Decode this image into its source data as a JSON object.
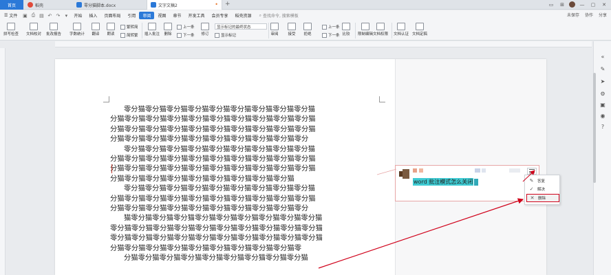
{
  "tabs": {
    "home": "首页",
    "docer": "稻壳",
    "doc1": "零分猫脚本.docx",
    "doc2": "文字文稿2",
    "add": "+"
  },
  "window": {
    "minimize": "—",
    "maximize": "▢",
    "close": "✕"
  },
  "menu": {
    "file": "文件",
    "items": [
      "开始",
      "插入",
      "页面布局",
      "引用",
      "审阅",
      "视图",
      "章节",
      "开发工具",
      "会员专享",
      "稻壳资源"
    ],
    "active_index": 4,
    "search_placeholder": "查找命令, 搜索模板",
    "right": [
      "未保存",
      "协作",
      "分享"
    ]
  },
  "ribbon": {
    "spell_check": "拼写检查",
    "doc_proof": "文档校对",
    "check_report": "批改报告",
    "word_count": "字数统计",
    "translate": "翻译",
    "read_aloud": "朗读",
    "trad": "繁转简",
    "simp": "简转繁",
    "insert_comment": "插入批注",
    "delete": "删除",
    "prev": "上一条",
    "next": "下一条",
    "track": "修订",
    "show_select": "显示标记的最终状态",
    "show_mark": "显示标记",
    "review": "审阅",
    "accept": "接受",
    "reject": "拒绝",
    "prev2": "上一条",
    "next2": "下一条",
    "compare": "比较",
    "restrict": "限制编辑",
    "permission": "文档权限",
    "certify": "文档认证",
    "finalize": "文档定稿"
  },
  "document": {
    "paragraphs": [
      [
        "零分猫零分猫零分猫零分猫零分猫零分猫零分猫零分猫零分猫",
        "分猫零分猫零分猫零分猫零分猫零分猫零分猫零分猫零分猫零分猫",
        "分猫零分猫零分猫零分猫零分猫零分猫零分猫零分猫零分猫零分猫",
        "分猫零分猫零分猫零分猫零分猫零分猫零分猫零分猫零分猫零分"
      ],
      [
        "零分猫零分猫零分猫零分猫零分猫零分猫零分猫零分猫零分猫",
        "分猫零分猫零分猫零分猫零分猫零分猫零分猫零分猫零分猫零分猫",
        "分猫零分猫零分猫零分猫零分猫零分猫零分猫零分猫零分猫零分猫",
        "分猫零分猫零分猫零分猫零分猫零分猫零分猫零分猫零分猫"
      ],
      [
        "零分猫零分猫零分猫零分猫零分猫零分猫零分猫零分猫零分猫",
        "分猫零分猫零分猫零分猫零分猫零分猫零分猫零分猫零分猫零分猫",
        "分猫零分猫零分猫零分猫零分猫零分猫零分猫零分猫零分猫零分"
      ],
      [
        "猫零分猫零分猫零分猫零分猫零分猫零分猫零分猫零分猫零分猫",
        "零分猫零分猫零分猫零分猫零分猫零分猫零分猫零分猫零分猫零分猫",
        "零分猫零分猫零分猫零分猫零分猫零分猫零分猫零分猫零分猫零分猫",
        "分猫零分猫零分猫零分猫零分猫零分猫零分猫零分猫零分猫零"
      ],
      [
        "分猫零分猫零分猫零分猫零分猫零分猫零分猫零分猫零分猫"
      ]
    ]
  },
  "comment": {
    "text": "word 批注模式怎么关闭",
    "menu": {
      "reply": "答复",
      "resolve": "解决",
      "delete": "删除"
    }
  },
  "colors": {
    "accent": "#2b79d8",
    "highlight": "#3ecbd3",
    "annotation_red": "#d0021b"
  }
}
